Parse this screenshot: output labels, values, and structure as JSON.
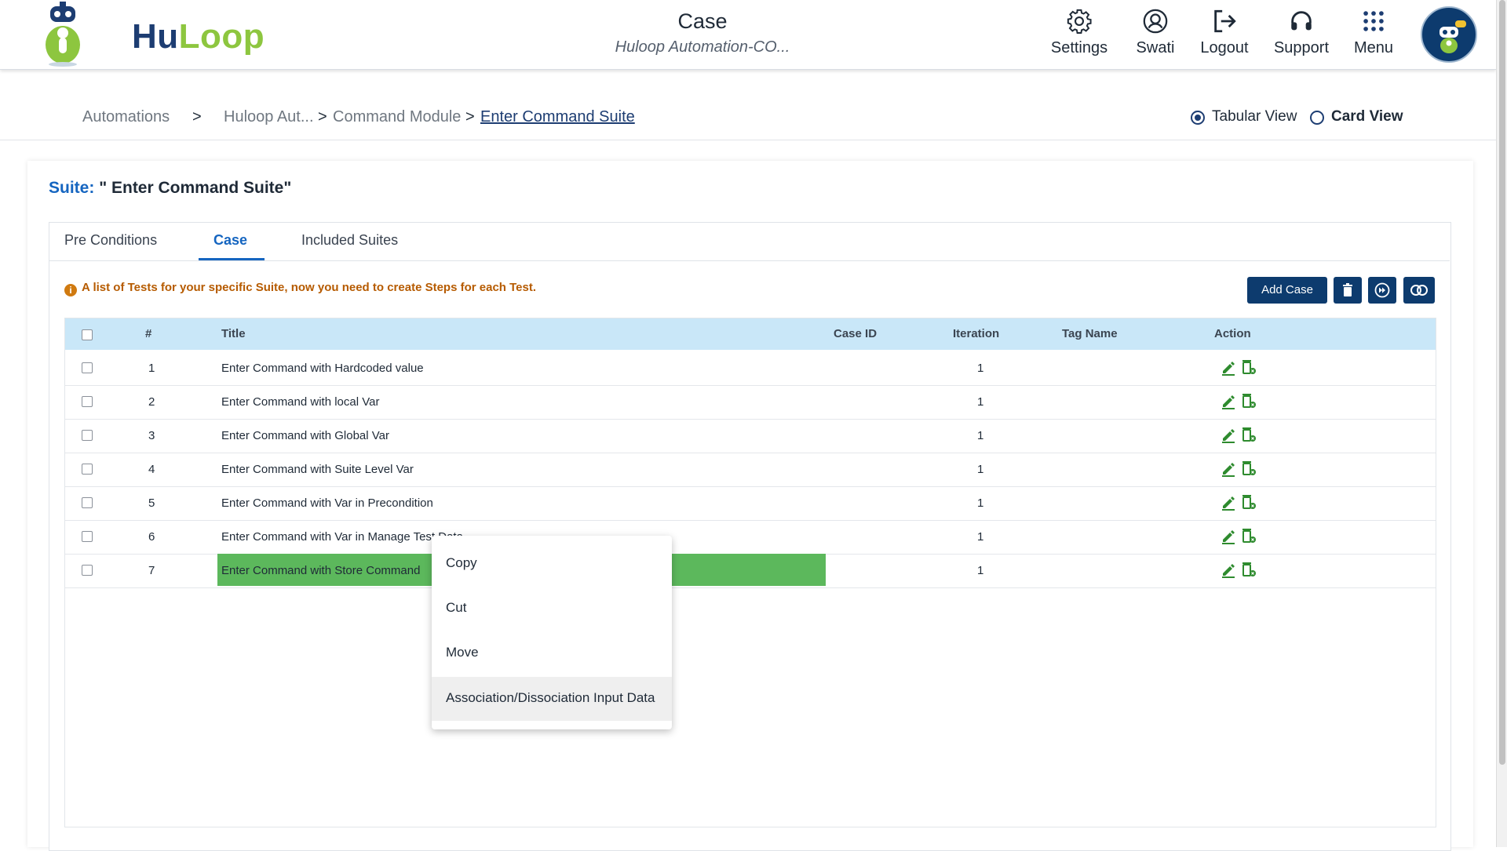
{
  "header": {
    "brand_hu": "Hu",
    "brand_loop": "Loop",
    "title": "Case",
    "subtitle": "Huloop Automation-CO...",
    "nav": [
      {
        "label": "Settings",
        "icon": "gear-icon"
      },
      {
        "label": "Swati",
        "icon": "user-icon"
      },
      {
        "label": "Logout",
        "icon": "logout-icon"
      },
      {
        "label": "Support",
        "icon": "headphones-icon"
      },
      {
        "label": "Menu",
        "icon": "grid-icon"
      }
    ]
  },
  "breadcrumb": {
    "items": [
      "Automations",
      "Huloop Aut...",
      "Command Module",
      "Enter Command Suite"
    ],
    "separator": ">"
  },
  "view_toggle": {
    "tabular": "Tabular View",
    "card": "Card View",
    "selected": "Tabular View"
  },
  "suite": {
    "label": "Suite:",
    "name": "\" Enter Command Suite\""
  },
  "tabs": {
    "items": [
      "Pre Conditions",
      "Case",
      "Included Suites"
    ],
    "active": "Case"
  },
  "info_text": "A list of Tests for your specific Suite, now you need to create Steps for each Test.",
  "toolbar": {
    "add_case": "Add Case"
  },
  "table": {
    "columns": {
      "index": "#",
      "title": "Title",
      "case_id": "Case ID",
      "iteration": "Iteration",
      "tag_name": "Tag Name",
      "action": "Action"
    },
    "rows": [
      {
        "index": "1",
        "title": "Enter Command with Hardcoded value",
        "case_id": "",
        "iteration": "1",
        "tag_name": ""
      },
      {
        "index": "2",
        "title": "Enter Command with local Var",
        "case_id": "",
        "iteration": "1",
        "tag_name": ""
      },
      {
        "index": "3",
        "title": "Enter Command with Global Var",
        "case_id": "",
        "iteration": "1",
        "tag_name": ""
      },
      {
        "index": "4",
        "title": "Enter Command with Suite Level Var",
        "case_id": "",
        "iteration": "1",
        "tag_name": ""
      },
      {
        "index": "5",
        "title": "Enter Command with Var in Precondition",
        "case_id": "",
        "iteration": "1",
        "tag_name": ""
      },
      {
        "index": "6",
        "title": "Enter Command with Var in Manage Test Data",
        "case_id": "",
        "iteration": "1",
        "tag_name": ""
      },
      {
        "index": "7",
        "title": "Enter Command with Store Command",
        "case_id": "",
        "iteration": "1",
        "tag_name": "",
        "highlighted": true
      }
    ]
  },
  "context_menu": {
    "items": [
      "Copy",
      "Cut",
      "Move",
      "Association/Dissociation Input Data"
    ],
    "hovered": "Association/Dissociation Input Data"
  },
  "colors": {
    "brand_navy": "#0d3b6e",
    "brand_green": "#8dc63f",
    "header_row": "#c9e7f8",
    "highlight_row": "#5cb85c",
    "info_orange": "#b65b00",
    "action_green": "#2e8b2e"
  }
}
